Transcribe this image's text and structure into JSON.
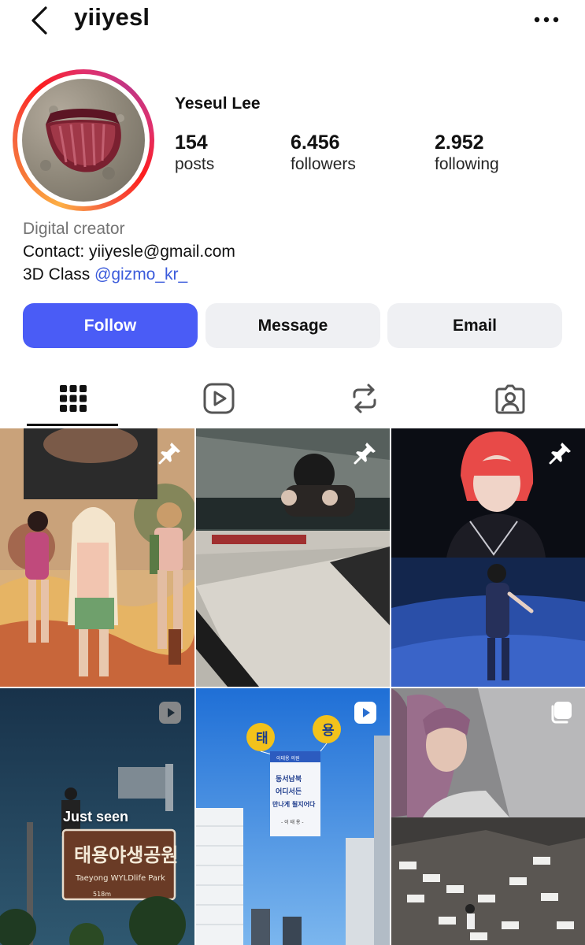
{
  "header": {
    "username": "yiiyesl",
    "back_icon": "chevron-left-icon",
    "more_icon": "ellipsis-icon"
  },
  "profile": {
    "display_name": "Yeseul Lee",
    "stats": [
      {
        "value": "154",
        "label": "posts"
      },
      {
        "value": "6.456",
        "label": "followers"
      },
      {
        "value": "2.952",
        "label": "following"
      }
    ],
    "category": "Digital creator",
    "contact": "Contact: yiiyesle@gmail.com",
    "class_prefix": "3D Class ",
    "class_handle": "@gizmo_kr_"
  },
  "actions": {
    "follow": "Follow",
    "message": "Message",
    "email": "Email"
  },
  "tabs": [
    {
      "name": "grid",
      "icon": "grid-icon",
      "active": true
    },
    {
      "name": "reels",
      "icon": "reels-icon",
      "active": false
    },
    {
      "name": "reposts",
      "icon": "repost-icon",
      "active": false
    },
    {
      "name": "tagged",
      "icon": "tagged-person-icon",
      "active": false
    }
  ],
  "posts": [
    {
      "type": "pinned",
      "icon": "pin-icon"
    },
    {
      "type": "pinned",
      "icon": "pin-icon"
    },
    {
      "type": "pinned",
      "icon": "pin-icon"
    },
    {
      "type": "reel",
      "icon": "reel-play-icon",
      "overlay_text": "Just seen",
      "sign_text": "태용야생공원",
      "sign_sub": "Taeyong  WYLDlife  Park",
      "sign_distance": "518m"
    },
    {
      "type": "reel",
      "icon": "reel-play-icon",
      "balloon_left": "태",
      "balloon_right": "용",
      "banner_top": "이태용 의원",
      "banner_line1": "동서남북",
      "banner_line2": "어디서든",
      "banner_line3": "만나게 될지어다",
      "banner_sign": "- 이 태 용 -"
    },
    {
      "type": "carousel",
      "icon": "carousel-icon"
    }
  ],
  "colors": {
    "accent": "#4a5cf6",
    "secondary_button": "#eff0f3",
    "link": "#3b5bdb",
    "muted_text": "#737373"
  }
}
